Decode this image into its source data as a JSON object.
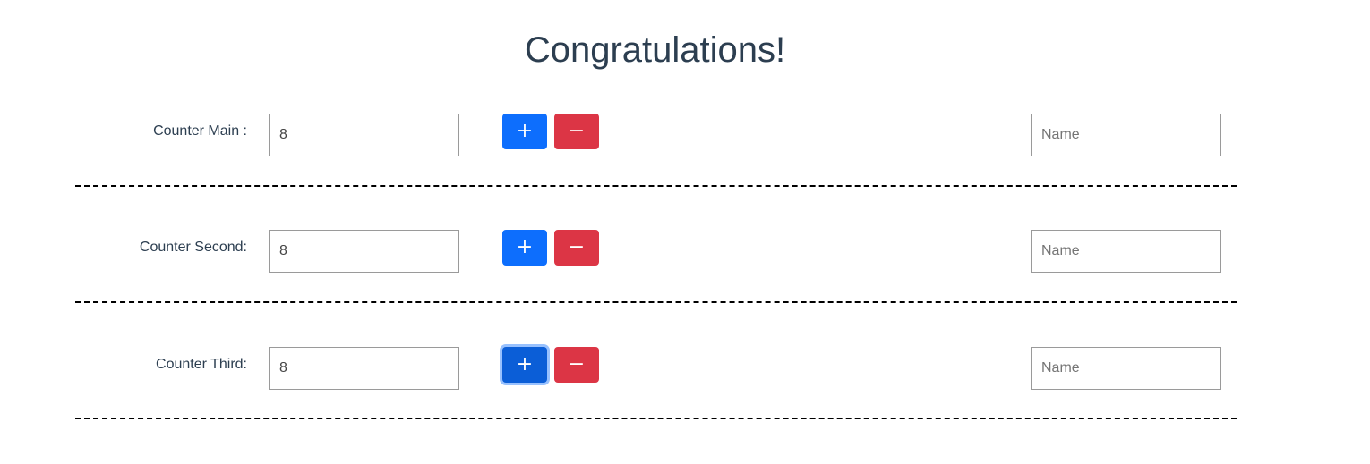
{
  "title": "Congratulations!",
  "counters": [
    {
      "label": "Counter Main :",
      "value": "8",
      "plus_label": "+",
      "minus_label": "−",
      "name_placeholder": "Name"
    },
    {
      "label": "Counter Second:",
      "value": "8",
      "plus_label": "+",
      "minus_label": "−",
      "name_placeholder": "Name"
    },
    {
      "label": "Counter Third:",
      "value": "8",
      "plus_label": "+",
      "minus_label": "−",
      "name_placeholder": "Name"
    }
  ],
  "colors": {
    "plus": "#0d6efd",
    "minus": "#dc3545",
    "text": "#2c3e50"
  }
}
